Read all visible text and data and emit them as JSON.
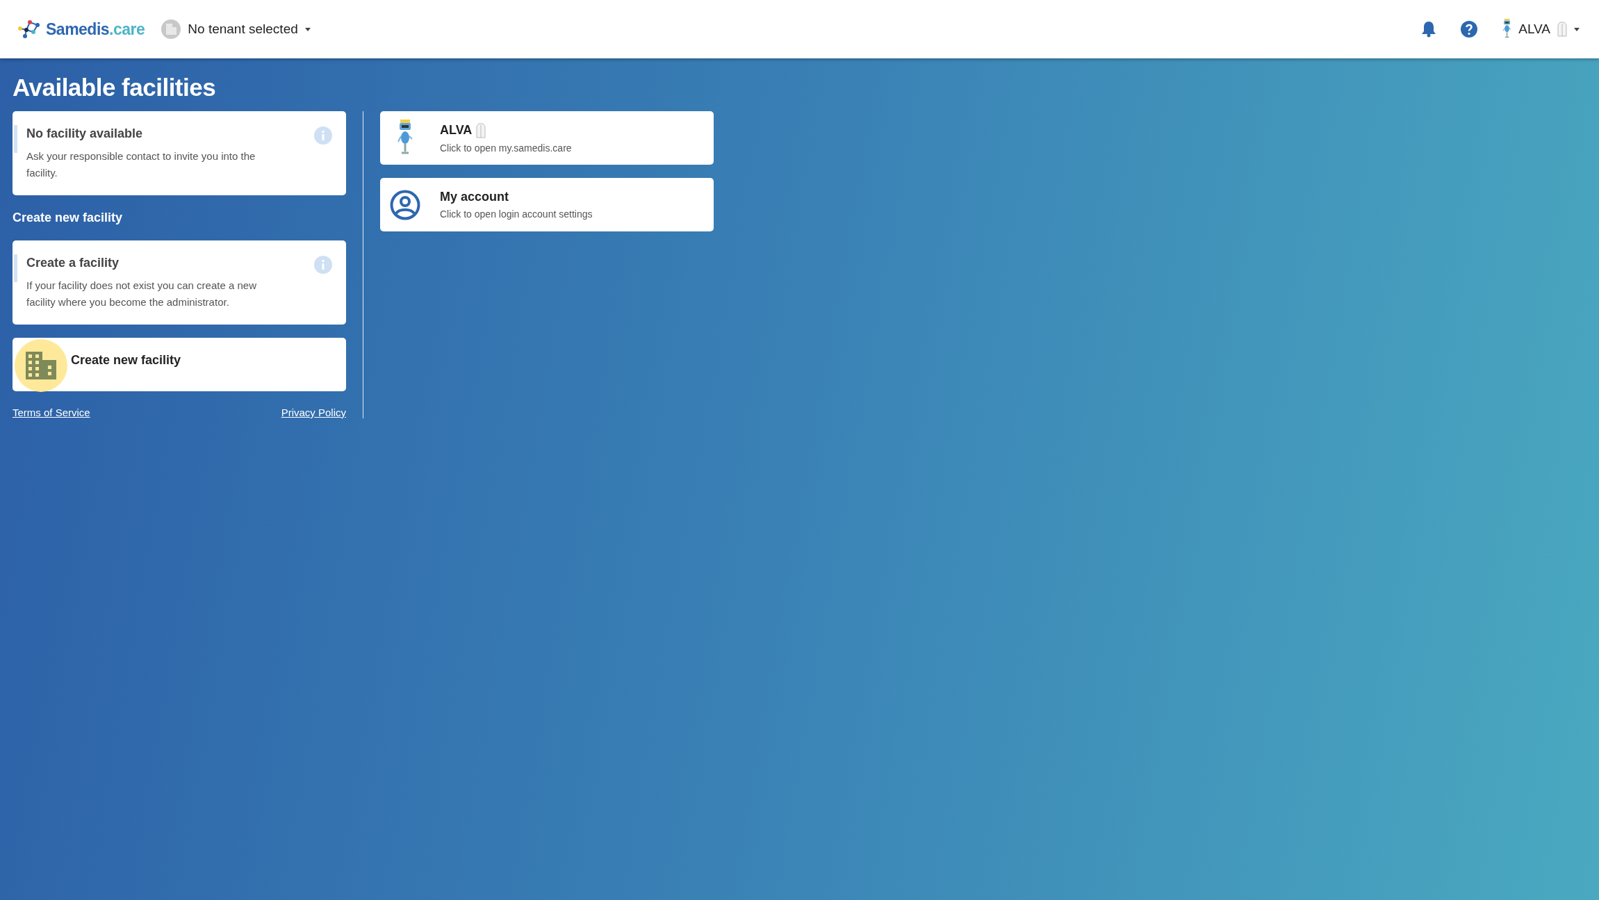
{
  "header": {
    "logo": {
      "brand": "Samedis",
      "suffix": ".care"
    },
    "tenant": {
      "label": "No tenant selected"
    },
    "user": {
      "name": "ALVA"
    }
  },
  "title": "Available facilities",
  "facilities_notice": {
    "title": "No facility available",
    "text": "Ask your responsible contact to invite you into the facility."
  },
  "create_section": {
    "heading": "Create new facility",
    "notice": {
      "title": "Create a facility",
      "text": "If your facility does not exist you can create a new facility where you become the administrator."
    },
    "button": {
      "label": "Create new facility",
      "highlighted": true
    }
  },
  "links": [
    {
      "label": "Terms of Service"
    },
    {
      "label": "Privacy Policy"
    }
  ],
  "shortcuts": [
    {
      "kind": "robot",
      "title": "ALVA",
      "coat": true,
      "subtitle": "Click to open my.samedis.care"
    },
    {
      "kind": "account",
      "title": "My account",
      "coat": false,
      "subtitle": "Click to open login account settings"
    }
  ]
}
